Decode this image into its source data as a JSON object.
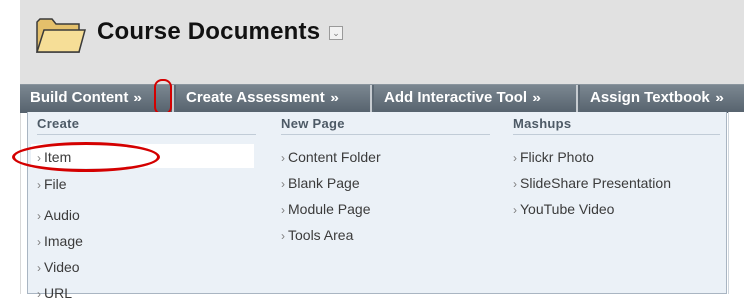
{
  "page": {
    "title": "Course Documents",
    "title_menu_icon": "chevron-down-icon"
  },
  "action_bar": {
    "buttons": [
      {
        "label": "Build Content",
        "icon": "double-chevron-down-icon"
      },
      {
        "label": "Create Assessment",
        "icon": "double-chevron-down-icon"
      },
      {
        "label": "Add Interactive Tool",
        "icon": "double-chevron-down-icon"
      },
      {
        "label": "Assign Textbook",
        "icon": "double-chevron-down-icon"
      }
    ]
  },
  "dropdown": {
    "columns": [
      {
        "heading": "Create",
        "items": [
          "Item",
          "File",
          "Audio",
          "Image",
          "Video",
          "URL"
        ]
      },
      {
        "heading": "New Page",
        "items": [
          "Content Folder",
          "Blank Page",
          "Module Page",
          "Tools Area"
        ]
      },
      {
        "heading": "Mashups",
        "items": [
          "Flickr Photo",
          "SlideShare Presentation",
          "YouTube Video"
        ]
      }
    ]
  },
  "colors": {
    "header_bg": "#e1e1e1",
    "action_bar_bg": "#5c6873",
    "dropdown_bg": "#ebf1f7",
    "annotation_red": "#d40000"
  }
}
